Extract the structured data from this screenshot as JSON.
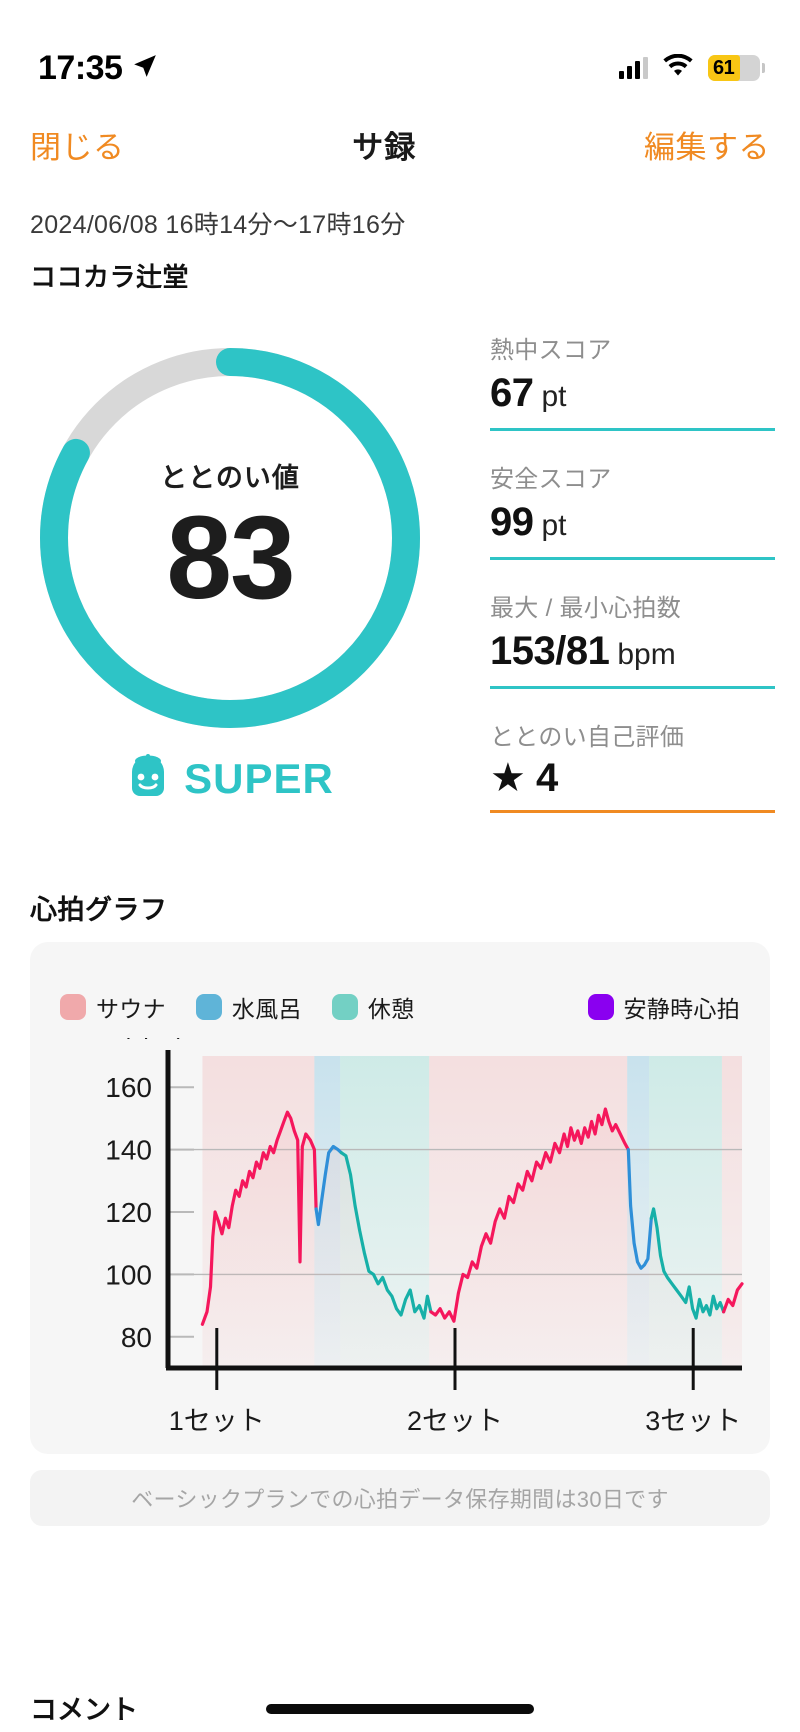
{
  "status_bar": {
    "time": "17:35",
    "location_icon": "location-arrow-icon",
    "cellular_icon": "cellular-bars-icon",
    "wifi_icon": "wifi-icon",
    "battery_percent": "61",
    "battery_level": 61,
    "battery_color": "#f8c614"
  },
  "nav": {
    "close_label": "閉じる",
    "title": "サ録",
    "edit_label": "編集する",
    "accent_color": "#f08a22"
  },
  "session": {
    "datetime": "2024/06/08 16時14分〜17時16分",
    "place": "ココカラ辻堂"
  },
  "score_ring": {
    "label": "ととのい値",
    "value": "83",
    "percent": 83,
    "ring_color": "#2ec4c6",
    "track_color": "#d8d8d8",
    "badge_text": "SUPER",
    "badge_icon": "sauna-character-icon",
    "badge_color": "#2ec4c6"
  },
  "stats": [
    {
      "label": "熱中スコア",
      "value": "67",
      "unit": "pt",
      "underline": "#2ec4c6"
    },
    {
      "label": "安全スコア",
      "value": "99",
      "unit": "pt",
      "underline": "#2ec4c6"
    },
    {
      "label": "最大 / 最小心拍数",
      "value": "153/81",
      "unit": "bpm",
      "underline": "#2ec4c6"
    },
    {
      "label": "ととのい自己評価",
      "value": "★ 4",
      "unit": "",
      "underline": "#f08a22"
    }
  ],
  "heart_rate_section": {
    "title": "心拍グラフ",
    "plan_note": "ベーシックプランでの心拍データ保存期間は30日です"
  },
  "comment_section": {
    "title": "コメント"
  },
  "chart_data": {
    "type": "line",
    "title": "心拍グラフ",
    "xlabel": "",
    "ylabel": "(bpm)",
    "ylim": [
      70,
      170
    ],
    "yticks": [
      80,
      100,
      120,
      140,
      160
    ],
    "gridlines": [
      100,
      140
    ],
    "grid": true,
    "legend_position": "top",
    "legend": [
      {
        "name": "サウナ",
        "color": "#f0a9ab"
      },
      {
        "name": "水風呂",
        "color": "#5fb4d8"
      },
      {
        "name": "休憩",
        "color": "#73d0c4"
      },
      {
        "name": "安静時心拍",
        "color": "#8a00f0"
      }
    ],
    "xticks": [
      {
        "label": "1セット",
        "x": 0.085
      },
      {
        "label": "2セット",
        "x": 0.5
      },
      {
        "label": "3セット",
        "x": 0.915
      }
    ],
    "phases": [
      {
        "type": "サウナ",
        "x0": 0.06,
        "x1": 0.255,
        "color": "#f0a9ab"
      },
      {
        "type": "水風呂",
        "x0": 0.255,
        "x1": 0.3,
        "color": "#5fb4d8"
      },
      {
        "type": "休憩",
        "x0": 0.3,
        "x1": 0.455,
        "color": "#73d0c4"
      },
      {
        "type": "サウナ",
        "x0": 0.455,
        "x1": 0.8,
        "color": "#f0a9ab"
      },
      {
        "type": "水風呂",
        "x0": 0.8,
        "x1": 0.838,
        "color": "#5fb4d8"
      },
      {
        "type": "休憩",
        "x0": 0.838,
        "x1": 0.965,
        "color": "#73d0c4"
      },
      {
        "type": "サウナ",
        "x0": 0.965,
        "x1": 1.0,
        "color": "#f0a9ab"
      }
    ],
    "series": [
      {
        "name": "心拍数",
        "segment_colors": {
          "サウナ": "#f5175c",
          "水風呂": "#2f8fd8",
          "休憩": "#17b0a8"
        },
        "points": [
          {
            "x": 0.06,
            "y": 84,
            "p": "サウナ"
          },
          {
            "x": 0.068,
            "y": 88,
            "p": "サウナ"
          },
          {
            "x": 0.074,
            "y": 96,
            "p": "サウナ"
          },
          {
            "x": 0.078,
            "y": 112,
            "p": "サウナ"
          },
          {
            "x": 0.082,
            "y": 120,
            "p": "サウナ"
          },
          {
            "x": 0.088,
            "y": 117,
            "p": "サウナ"
          },
          {
            "x": 0.094,
            "y": 113,
            "p": "サウナ"
          },
          {
            "x": 0.1,
            "y": 118,
            "p": "サウナ"
          },
          {
            "x": 0.106,
            "y": 115,
            "p": "サウナ"
          },
          {
            "x": 0.112,
            "y": 122,
            "p": "サウナ"
          },
          {
            "x": 0.118,
            "y": 127,
            "p": "サウナ"
          },
          {
            "x": 0.124,
            "y": 125,
            "p": "サウナ"
          },
          {
            "x": 0.13,
            "y": 130,
            "p": "サウナ"
          },
          {
            "x": 0.136,
            "y": 128,
            "p": "サウナ"
          },
          {
            "x": 0.142,
            "y": 133,
            "p": "サウナ"
          },
          {
            "x": 0.148,
            "y": 131,
            "p": "サウナ"
          },
          {
            "x": 0.154,
            "y": 136,
            "p": "サウナ"
          },
          {
            "x": 0.16,
            "y": 134,
            "p": "サウナ"
          },
          {
            "x": 0.166,
            "y": 139,
            "p": "サウナ"
          },
          {
            "x": 0.172,
            "y": 137,
            "p": "サウナ"
          },
          {
            "x": 0.178,
            "y": 141,
            "p": "サウナ"
          },
          {
            "x": 0.184,
            "y": 139,
            "p": "サウナ"
          },
          {
            "x": 0.19,
            "y": 143,
            "p": "サウナ"
          },
          {
            "x": 0.196,
            "y": 146,
            "p": "サウナ"
          },
          {
            "x": 0.202,
            "y": 149,
            "p": "サウナ"
          },
          {
            "x": 0.208,
            "y": 152,
            "p": "サウナ"
          },
          {
            "x": 0.214,
            "y": 150,
            "p": "サウナ"
          },
          {
            "x": 0.22,
            "y": 146,
            "p": "サウナ"
          },
          {
            "x": 0.226,
            "y": 143,
            "p": "サウナ"
          },
          {
            "x": 0.23,
            "y": 104,
            "p": "サウナ"
          },
          {
            "x": 0.234,
            "y": 141,
            "p": "サウナ"
          },
          {
            "x": 0.24,
            "y": 145,
            "p": "サウナ"
          },
          {
            "x": 0.248,
            "y": 143,
            "p": "サウナ"
          },
          {
            "x": 0.255,
            "y": 140,
            "p": "サウナ"
          },
          {
            "x": 0.258,
            "y": 121,
            "p": "水風呂"
          },
          {
            "x": 0.262,
            "y": 116,
            "p": "水風呂"
          },
          {
            "x": 0.268,
            "y": 124,
            "p": "水風呂"
          },
          {
            "x": 0.274,
            "y": 132,
            "p": "水風呂"
          },
          {
            "x": 0.28,
            "y": 139,
            "p": "水風呂"
          },
          {
            "x": 0.288,
            "y": 141,
            "p": "水風呂"
          },
          {
            "x": 0.296,
            "y": 140,
            "p": "水風呂"
          },
          {
            "x": 0.302,
            "y": 139,
            "p": "休憩"
          },
          {
            "x": 0.31,
            "y": 138,
            "p": "休憩"
          },
          {
            "x": 0.318,
            "y": 132,
            "p": "休憩"
          },
          {
            "x": 0.326,
            "y": 122,
            "p": "休憩"
          },
          {
            "x": 0.334,
            "y": 114,
            "p": "休憩"
          },
          {
            "x": 0.342,
            "y": 107,
            "p": "休憩"
          },
          {
            "x": 0.35,
            "y": 101,
            "p": "休憩"
          },
          {
            "x": 0.358,
            "y": 100,
            "p": "休憩"
          },
          {
            "x": 0.366,
            "y": 97,
            "p": "休憩"
          },
          {
            "x": 0.374,
            "y": 99,
            "p": "休憩"
          },
          {
            "x": 0.382,
            "y": 95,
            "p": "休憩"
          },
          {
            "x": 0.39,
            "y": 93,
            "p": "休憩"
          },
          {
            "x": 0.398,
            "y": 89,
            "p": "休憩"
          },
          {
            "x": 0.406,
            "y": 87,
            "p": "休憩"
          },
          {
            "x": 0.414,
            "y": 92,
            "p": "休憩"
          },
          {
            "x": 0.422,
            "y": 95,
            "p": "休憩"
          },
          {
            "x": 0.43,
            "y": 88,
            "p": "休憩"
          },
          {
            "x": 0.438,
            "y": 90,
            "p": "休憩"
          },
          {
            "x": 0.446,
            "y": 86,
            "p": "休憩"
          },
          {
            "x": 0.452,
            "y": 93,
            "p": "休憩"
          },
          {
            "x": 0.458,
            "y": 88,
            "p": "サウナ"
          },
          {
            "x": 0.466,
            "y": 87,
            "p": "サウナ"
          },
          {
            "x": 0.474,
            "y": 89,
            "p": "サウナ"
          },
          {
            "x": 0.482,
            "y": 86,
            "p": "サウナ"
          },
          {
            "x": 0.49,
            "y": 88,
            "p": "サウナ"
          },
          {
            "x": 0.498,
            "y": 85,
            "p": "サウナ"
          },
          {
            "x": 0.506,
            "y": 94,
            "p": "サウナ"
          },
          {
            "x": 0.514,
            "y": 100,
            "p": "サウナ"
          },
          {
            "x": 0.522,
            "y": 99,
            "p": "サウナ"
          },
          {
            "x": 0.53,
            "y": 104,
            "p": "サウナ"
          },
          {
            "x": 0.538,
            "y": 102,
            "p": "サウナ"
          },
          {
            "x": 0.546,
            "y": 109,
            "p": "サウナ"
          },
          {
            "x": 0.554,
            "y": 113,
            "p": "サウナ"
          },
          {
            "x": 0.562,
            "y": 110,
            "p": "サウナ"
          },
          {
            "x": 0.57,
            "y": 117,
            "p": "サウナ"
          },
          {
            "x": 0.578,
            "y": 121,
            "p": "サウナ"
          },
          {
            "x": 0.586,
            "y": 118,
            "p": "サウナ"
          },
          {
            "x": 0.594,
            "y": 125,
            "p": "サウナ"
          },
          {
            "x": 0.602,
            "y": 123,
            "p": "サウナ"
          },
          {
            "x": 0.61,
            "y": 129,
            "p": "サウナ"
          },
          {
            "x": 0.618,
            "y": 127,
            "p": "サウナ"
          },
          {
            "x": 0.626,
            "y": 133,
            "p": "サウナ"
          },
          {
            "x": 0.634,
            "y": 130,
            "p": "サウナ"
          },
          {
            "x": 0.642,
            "y": 136,
            "p": "サウナ"
          },
          {
            "x": 0.65,
            "y": 134,
            "p": "サウナ"
          },
          {
            "x": 0.658,
            "y": 139,
            "p": "サウナ"
          },
          {
            "x": 0.666,
            "y": 136,
            "p": "サウナ"
          },
          {
            "x": 0.674,
            "y": 142,
            "p": "サウナ"
          },
          {
            "x": 0.682,
            "y": 139,
            "p": "サウナ"
          },
          {
            "x": 0.69,
            "y": 145,
            "p": "サウナ"
          },
          {
            "x": 0.696,
            "y": 141,
            "p": "サウナ"
          },
          {
            "x": 0.702,
            "y": 147,
            "p": "サウナ"
          },
          {
            "x": 0.708,
            "y": 143,
            "p": "サウナ"
          },
          {
            "x": 0.714,
            "y": 146,
            "p": "サウナ"
          },
          {
            "x": 0.72,
            "y": 142,
            "p": "サウナ"
          },
          {
            "x": 0.726,
            "y": 147,
            "p": "サウナ"
          },
          {
            "x": 0.732,
            "y": 144,
            "p": "サウナ"
          },
          {
            "x": 0.738,
            "y": 149,
            "p": "サウナ"
          },
          {
            "x": 0.744,
            "y": 145,
            "p": "サウナ"
          },
          {
            "x": 0.75,
            "y": 151,
            "p": "サウナ"
          },
          {
            "x": 0.756,
            "y": 148,
            "p": "サウナ"
          },
          {
            "x": 0.762,
            "y": 153,
            "p": "サウナ"
          },
          {
            "x": 0.768,
            "y": 149,
            "p": "サウナ"
          },
          {
            "x": 0.774,
            "y": 146,
            "p": "サウナ"
          },
          {
            "x": 0.78,
            "y": 148,
            "p": "サウナ"
          },
          {
            "x": 0.788,
            "y": 145,
            "p": "サウナ"
          },
          {
            "x": 0.796,
            "y": 142,
            "p": "サウナ"
          },
          {
            "x": 0.802,
            "y": 140,
            "p": "水風呂"
          },
          {
            "x": 0.806,
            "y": 122,
            "p": "水風呂"
          },
          {
            "x": 0.812,
            "y": 110,
            "p": "水風呂"
          },
          {
            "x": 0.818,
            "y": 104,
            "p": "水風呂"
          },
          {
            "x": 0.824,
            "y": 102,
            "p": "水風呂"
          },
          {
            "x": 0.83,
            "y": 103,
            "p": "水風呂"
          },
          {
            "x": 0.836,
            "y": 105,
            "p": "水風呂"
          },
          {
            "x": 0.842,
            "y": 118,
            "p": "休憩"
          },
          {
            "x": 0.846,
            "y": 121,
            "p": "休憩"
          },
          {
            "x": 0.852,
            "y": 115,
            "p": "休憩"
          },
          {
            "x": 0.858,
            "y": 106,
            "p": "休憩"
          },
          {
            "x": 0.864,
            "y": 101,
            "p": "休憩"
          },
          {
            "x": 0.87,
            "y": 99,
            "p": "休憩"
          },
          {
            "x": 0.878,
            "y": 97,
            "p": "休憩"
          },
          {
            "x": 0.886,
            "y": 95,
            "p": "休憩"
          },
          {
            "x": 0.894,
            "y": 93,
            "p": "休憩"
          },
          {
            "x": 0.902,
            "y": 91,
            "p": "休憩"
          },
          {
            "x": 0.908,
            "y": 96,
            "p": "休憩"
          },
          {
            "x": 0.914,
            "y": 89,
            "p": "休憩"
          },
          {
            "x": 0.92,
            "y": 86,
            "p": "休憩"
          },
          {
            "x": 0.926,
            "y": 92,
            "p": "休憩"
          },
          {
            "x": 0.932,
            "y": 88,
            "p": "休憩"
          },
          {
            "x": 0.938,
            "y": 90,
            "p": "休憩"
          },
          {
            "x": 0.944,
            "y": 87,
            "p": "休憩"
          },
          {
            "x": 0.95,
            "y": 93,
            "p": "休憩"
          },
          {
            "x": 0.956,
            "y": 89,
            "p": "休憩"
          },
          {
            "x": 0.962,
            "y": 91,
            "p": "休憩"
          },
          {
            "x": 0.968,
            "y": 88,
            "p": "サウナ"
          },
          {
            "x": 0.976,
            "y": 92,
            "p": "サウナ"
          },
          {
            "x": 0.984,
            "y": 90,
            "p": "サウナ"
          },
          {
            "x": 0.992,
            "y": 95,
            "p": "サウナ"
          },
          {
            "x": 1.0,
            "y": 97,
            "p": "サウナ"
          }
        ]
      }
    ]
  }
}
